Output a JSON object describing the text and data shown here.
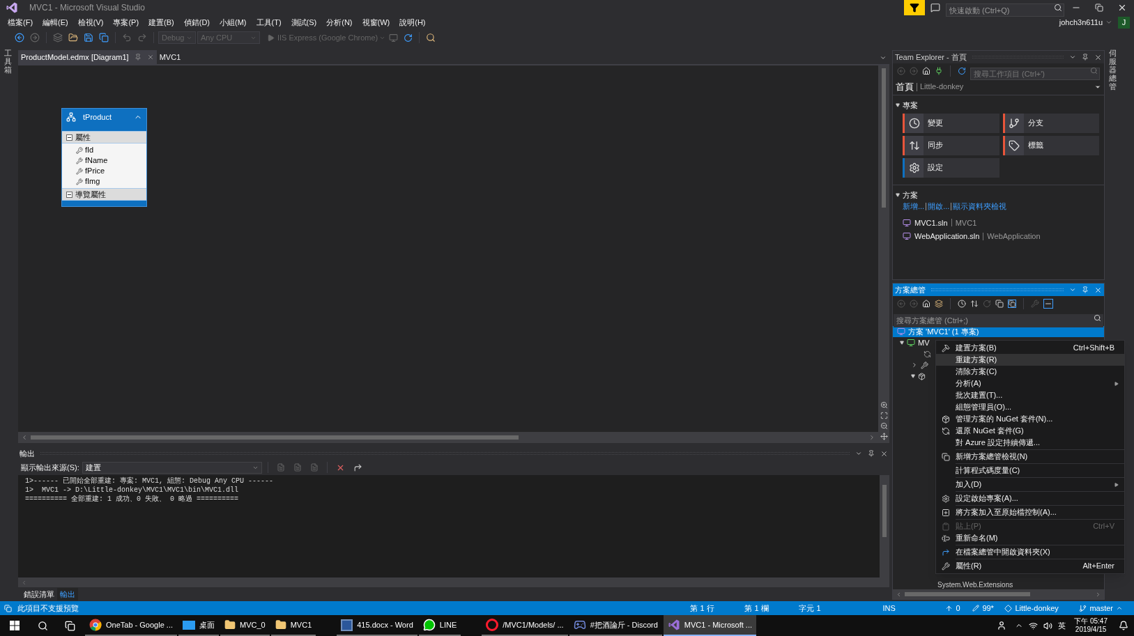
{
  "window": {
    "title": "MVC1 - Microsoft Visual Studio",
    "quick_launch": {
      "placeholder": "快速啟動 (Ctrl+Q)"
    },
    "user": "johch3n611u",
    "avatar": "J"
  },
  "menu": [
    "檔案(F)",
    "編輯(E)",
    "檢視(V)",
    "專案(P)",
    "建置(B)",
    "偵錯(D)",
    "小組(M)",
    "工具(T)",
    "測試(S)",
    "分析(N)",
    "視窗(W)",
    "說明(H)"
  ],
  "toolbar": {
    "configuration": "Debug",
    "platform": "Any CPU",
    "run_target": "IIS Express (Google Chrome)"
  },
  "left_strip": "工具箱",
  "right_strip": "伺服器總管",
  "document_tabs": [
    {
      "label": "ProductModel.edmx [Diagram1]",
      "selected": true
    },
    {
      "label": "MVC1",
      "selected": false
    }
  ],
  "entity": {
    "name": "tProduct",
    "sections": [
      {
        "title": "屬性",
        "expanded": true,
        "items": [
          {
            "name": "fId",
            "kind": "key"
          },
          {
            "name": "fName",
            "kind": "property"
          },
          {
            "name": "fPrice",
            "kind": "property"
          },
          {
            "name": "fImg",
            "kind": "property"
          }
        ]
      },
      {
        "title": "導覽屬性",
        "expanded": true
      }
    ]
  },
  "output": {
    "title": "輸出",
    "source_label": "顯示輸出來源(S):",
    "source": "建置",
    "lines": [
      "1>------ 已開始全部重建: 專案: MVC1, 組態: Debug Any CPU ------",
      "1>  MVC1 -> D:\\Little-donkey\\MVC1\\MVC1\\bin\\MVC1.dll",
      "========== 全部重建: 1 成功、0 失敗、 0 略過 =========="
    ]
  },
  "bottom_tabs": [
    {
      "label": "錯誤清單",
      "selected": false
    },
    {
      "label": "輸出",
      "selected": true
    }
  ],
  "team_explorer": {
    "title": "Team Explorer - 首頁",
    "search": {
      "placeholder": "搜尋工作項目 (Ctrl+')"
    },
    "page": "首頁",
    "context": "Little-donkey",
    "project_section": "專案",
    "tiles": [
      {
        "label": "變更",
        "color": "#e8553a"
      },
      {
        "label": "分支",
        "color": "#e8553a"
      },
      {
        "label": "同步",
        "color": "#e8553a"
      },
      {
        "label": "標籤",
        "color": "#e8553a"
      },
      {
        "label": "設定",
        "color": "#0e70c0"
      }
    ],
    "solutions_section": "方案",
    "links": [
      "新增...",
      "開啟...",
      "顯示資料夾檢視"
    ],
    "solutions": [
      {
        "file": "MVC1.sln",
        "name": "MVC1"
      },
      {
        "file": "WebApplication.sln",
        "name": "WebApplication"
      }
    ]
  },
  "solution_explorer": {
    "title": "方案總管",
    "search": {
      "placeholder": "搜尋方案總管 (Ctrl+;)"
    },
    "root": {
      "label": "方案 'MVC1' (1 專案)",
      "selected": true
    },
    "project": {
      "label": "MV",
      "selected": false
    },
    "bottom_item": "System.Web.Extensions"
  },
  "context_menu": [
    {
      "kind": "item",
      "label": "建置方案(B)",
      "shortcut": "Ctrl+Shift+B",
      "selected": false,
      "disabled": false,
      "submenu": false
    },
    {
      "kind": "item",
      "label": "重建方案(R)",
      "selected": true,
      "disabled": false,
      "submenu": false
    },
    {
      "kind": "item",
      "label": "清除方案(C)",
      "selected": false,
      "disabled": false,
      "submenu": false
    },
    {
      "kind": "item",
      "label": "分析(A)",
      "selected": false,
      "disabled": false,
      "submenu": true
    },
    {
      "kind": "item",
      "label": "批次建置(T)...",
      "selected": false,
      "disabled": false,
      "submenu": false
    },
    {
      "kind": "item",
      "label": "組態管理員(O)...",
      "selected": false,
      "disabled": false,
      "submenu": false
    },
    {
      "kind": "item",
      "label": "管理方案的 NuGet 套件(N)...",
      "selected": false,
      "disabled": false,
      "submenu": false
    },
    {
      "kind": "item",
      "label": "還原 NuGet 套件(G)",
      "selected": false,
      "disabled": false,
      "submenu": false
    },
    {
      "kind": "item",
      "label": "對 Azure 設定持續傳遞...",
      "selected": false,
      "disabled": false,
      "submenu": false
    },
    {
      "kind": "separator"
    },
    {
      "kind": "item",
      "label": "新增方案總管檢視(N)",
      "selected": false,
      "disabled": false,
      "submenu": false
    },
    {
      "kind": "separator"
    },
    {
      "kind": "item",
      "label": "計算程式碼度量(C)",
      "selected": false,
      "disabled": false,
      "submenu": false
    },
    {
      "kind": "separator"
    },
    {
      "kind": "item",
      "label": "加入(D)",
      "selected": false,
      "disabled": false,
      "submenu": true
    },
    {
      "kind": "separator"
    },
    {
      "kind": "item",
      "label": "設定啟始專案(A)...",
      "selected": false,
      "disabled": false,
      "submenu": false
    },
    {
      "kind": "separator"
    },
    {
      "kind": "item",
      "label": "將方案加入至原始檔控制(A)...",
      "selected": false,
      "disabled": false,
      "submenu": false
    },
    {
      "kind": "separator"
    },
    {
      "kind": "item",
      "label": "貼上(P)",
      "shortcut": "Ctrl+V",
      "selected": false,
      "disabled": true,
      "submenu": false
    },
    {
      "kind": "item",
      "label": "重新命名(M)",
      "selected": false,
      "disabled": false,
      "submenu": false
    },
    {
      "kind": "separator"
    },
    {
      "kind": "item",
      "label": "在檔案總管中開啟資料夾(X)",
      "selected": false,
      "disabled": false,
      "submenu": false
    },
    {
      "kind": "separator"
    },
    {
      "kind": "item",
      "label": "屬性(R)",
      "shortcut": "Alt+Enter",
      "selected": false,
      "disabled": false,
      "submenu": false
    }
  ],
  "status_bar": {
    "message": "此項目不支援預覽",
    "line": "第 1 行",
    "column": "第 1 欄",
    "char": "字元 1",
    "mode": "INS",
    "pending": "0",
    "edits": "99*",
    "repo": "Little-donkey",
    "branch": "master"
  },
  "taskbar": {
    "apps": [
      {
        "label": "OneTab - Google ...",
        "selected": false
      },
      {
        "label": "桌面",
        "selected": false
      },
      {
        "label": "MVC_0",
        "selected": false
      },
      {
        "label": "MVC1",
        "selected": false
      },
      {
        "label": "415.docx - Word",
        "selected": false
      },
      {
        "label": "LINE",
        "selected": false
      },
      {
        "label": "/MVC1/Models/ ...",
        "selected": false
      },
      {
        "label": "#把酒論斤 - Discord",
        "selected": false
      },
      {
        "label": "MVC1 - Microsoft ...",
        "selected": true
      }
    ],
    "ime": "英",
    "time": "下午 05:47",
    "date": "2019/4/15"
  }
}
